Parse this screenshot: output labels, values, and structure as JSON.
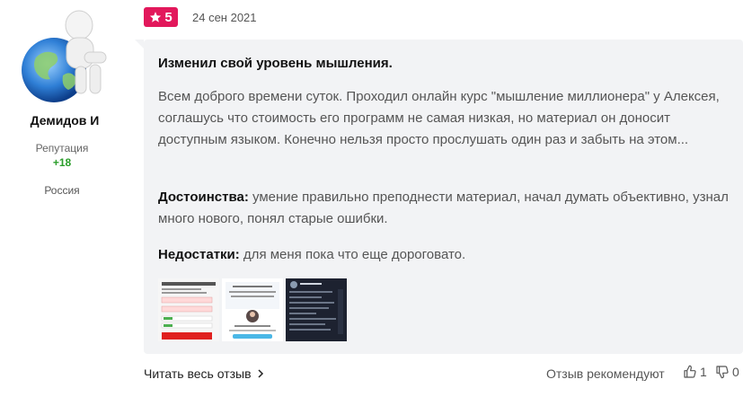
{
  "author": {
    "name": "Демидов И",
    "reputation_label": "Репутация",
    "reputation_value": "+18",
    "country": "Россия"
  },
  "review": {
    "rating": "5",
    "date": "24 сен 2021",
    "title": "Изменил свой уровень мышления.",
    "body": "Всем доброго времени суток. Проходил онлайн курс \"мышление миллионера\" у Алексея, соглашусь что стоимость его программ не самая низкая, но материал он доносит доступным языком. Конечно нельзя просто прослушать один раз и забыть на этом...",
    "pros_label": "Достоинства:",
    "pros_text": " умение правильно преподнести материал, начал думать объективно, узнал много нового, понял старые ошибки.",
    "cons_label": "Недостатки:",
    "cons_text": " для меня пока что еще дороговато.",
    "thumbnails": [
      {
        "name": "screenshot-course-form"
      },
      {
        "name": "screenshot-course-author"
      },
      {
        "name": "screenshot-dark-chat"
      }
    ]
  },
  "footer": {
    "read_more": "Читать весь отзыв",
    "recommend_label": "Отзыв рекомендуют",
    "likes": "1",
    "dislikes": "0"
  },
  "colors": {
    "rating_badge": "#e2185b",
    "reputation": "#2a9d2a",
    "card_background": "#f2f3f5"
  }
}
